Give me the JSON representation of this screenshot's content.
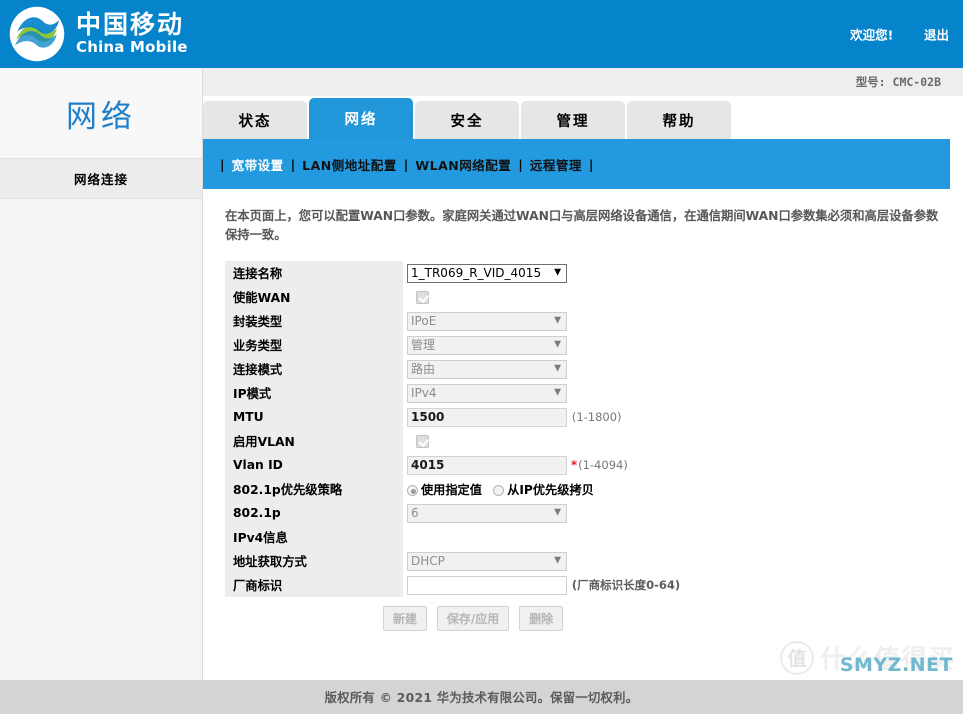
{
  "header": {
    "brand_cn": "中国移动",
    "brand_en": "China Mobile",
    "welcome": "欢迎您!",
    "logout": "退出",
    "brand_blue": "#0583cb"
  },
  "model_bar": {
    "text": "型号: CMC-02B"
  },
  "tabs": [
    {
      "label": "状态",
      "active": false
    },
    {
      "label": "网络",
      "active": true
    },
    {
      "label": "安全",
      "active": false
    },
    {
      "label": "管理",
      "active": false
    },
    {
      "label": "帮助",
      "active": false
    }
  ],
  "subnav": {
    "items": [
      {
        "label": "宽带设置",
        "active": true
      },
      {
        "label": "LAN侧地址配置",
        "active": false
      },
      {
        "label": "WLAN网络配置",
        "active": false
      },
      {
        "label": "远程管理",
        "active": false
      }
    ],
    "separator": "|",
    "bg": "#239ae0"
  },
  "sidebar": {
    "title": "网络",
    "items": [
      {
        "label": "网络连接"
      }
    ]
  },
  "main": {
    "description": "在本页面上，您可以配置WAN口参数。家庭网关通过WAN口与高层网络设备通信，在通信期间WAN口参数集必须和高层设备参数保持一致。",
    "fields": {
      "connection_name": {
        "label": "连接名称",
        "value": "1_TR069_R_VID_4015"
      },
      "enable_wan": {
        "label": "使能WAN",
        "checked": true
      },
      "encapsulation_type": {
        "label": "封装类型",
        "value": "IPoE"
      },
      "service_type": {
        "label": "业务类型",
        "value": "管理"
      },
      "connection_mode": {
        "label": "连接模式",
        "value": "路由"
      },
      "ip_mode": {
        "label": "IP模式",
        "value": "IPv4"
      },
      "mtu": {
        "label": "MTU",
        "value": "1500",
        "hint": "(1-1800)"
      },
      "enable_vlan": {
        "label": "启用VLAN",
        "checked": true
      },
      "vlan_id": {
        "label": "Vlan ID",
        "value": "4015",
        "star": "*",
        "hint": "(1-4094)"
      },
      "priority_policy": {
        "label": "802.1p优先级策略",
        "option_specified": "使用指定值",
        "option_copy": "从IP优先级拷贝",
        "selected": "使用指定值"
      },
      "dot1p": {
        "label": "802.1p",
        "value": "6"
      },
      "ipv4_info": {
        "label": "IPv4信息"
      },
      "address_mode": {
        "label": "地址获取方式",
        "value": "DHCP"
      },
      "vendor_id": {
        "label": "厂商标识",
        "value": "",
        "hint": "(厂商标识长度0-64)"
      }
    },
    "buttons": [
      {
        "label": "新建"
      },
      {
        "label": "保存/应用"
      },
      {
        "label": "删除"
      }
    ]
  },
  "footer": {
    "text": "版权所有 © 2021 华为技术有限公司。保留一切权利。"
  },
  "watermark": {
    "badge": "值",
    "text": "什么值得买",
    "site": "SMYZ.NET"
  }
}
